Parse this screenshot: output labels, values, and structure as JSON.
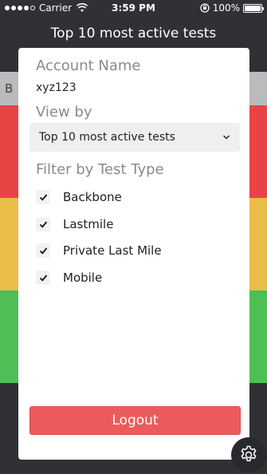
{
  "status_bar": {
    "carrier": "Carrier",
    "time": "3:59 PM",
    "battery": "100%",
    "battery_level": 1.0
  },
  "header": {
    "title": "Top 10 most active tests"
  },
  "background": {
    "grey_bar_text": "B"
  },
  "modal": {
    "account_label": "Account Name",
    "account_value": "xyz123",
    "view_by_label": "View by",
    "view_by_selected": "Top 10 most active tests",
    "filter_label": "Filter by Test Type",
    "filters": [
      {
        "label": "Backbone",
        "checked": true
      },
      {
        "label": "Lastmile",
        "checked": true
      },
      {
        "label": "Private Last Mile",
        "checked": true
      },
      {
        "label": "Mobile",
        "checked": true
      }
    ],
    "logout_label": "Logout"
  },
  "colors": {
    "red": "#e74446",
    "yellow": "#eabd4b",
    "green": "#4fbe57",
    "logout": "#ec5b5b",
    "dark_bg": "#2f3134"
  },
  "icons": {
    "gear": "gear-icon",
    "chevron": "chevron-down-icon",
    "check": "check-icon"
  }
}
